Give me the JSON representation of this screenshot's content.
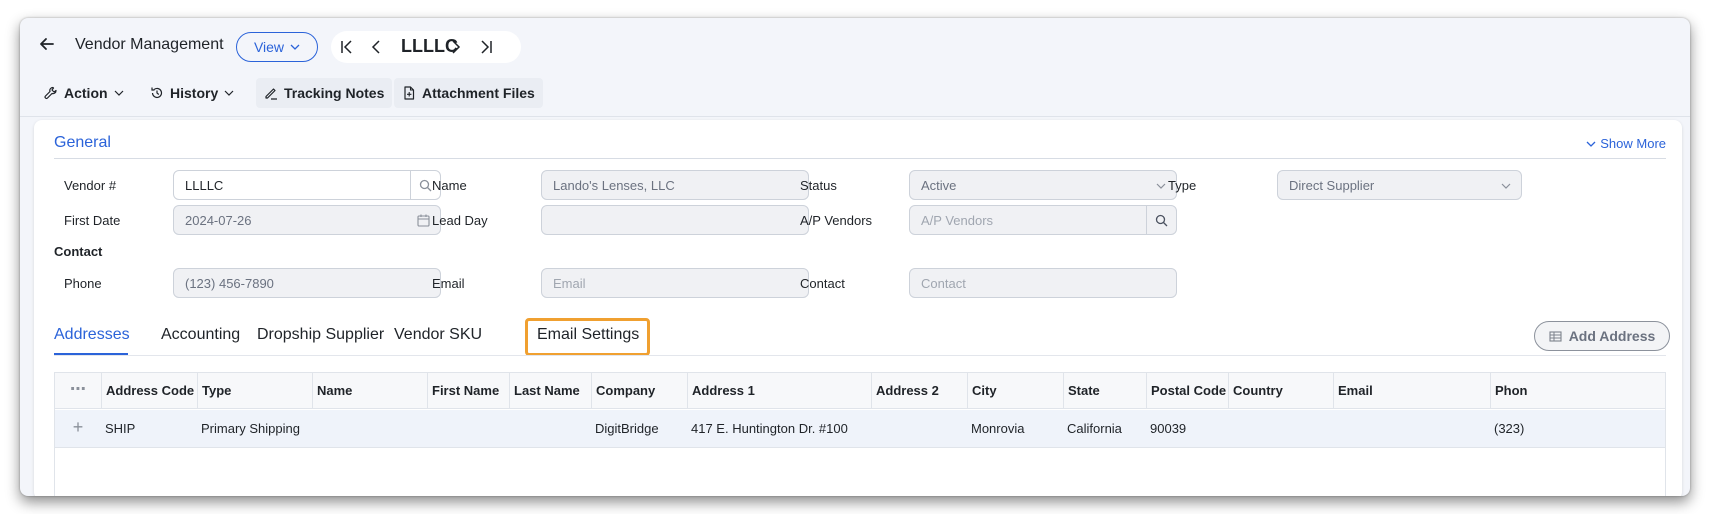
{
  "header": {
    "title": "Vendor Management",
    "view_label": "View",
    "record_id": "LLLLC"
  },
  "toolbar": {
    "action_label": "Action",
    "history_label": "History",
    "tracking_notes_label": "Tracking Notes",
    "attachment_files_label": "Attachment Files"
  },
  "general": {
    "section_title": "General",
    "show_more_label": "Show More",
    "fields": {
      "vendor_no": {
        "label": "Vendor #",
        "value": "LLLLC"
      },
      "name": {
        "label": "Name",
        "value": "Lando's Lenses, LLC"
      },
      "status": {
        "label": "Status",
        "value": "Active"
      },
      "type": {
        "label": "Type",
        "value": "Direct Supplier"
      },
      "first_date": {
        "label": "First Date",
        "value": "2024-07-26"
      },
      "lead_day": {
        "label": "Lead Day",
        "value": ""
      },
      "ap_vendors": {
        "label": "A/P Vendors",
        "placeholder": "A/P Vendors"
      }
    },
    "contact_heading": "Contact",
    "contact": {
      "phone": {
        "label": "Phone",
        "value": "(123) 456-7890"
      },
      "email": {
        "label": "Email",
        "placeholder": "Email"
      },
      "contact": {
        "label": "Contact",
        "placeholder": "Contact"
      }
    }
  },
  "tabs": {
    "items": [
      "Addresses",
      "Accounting",
      "Dropship Supplier",
      "Vendor SKU",
      "Email Settings"
    ],
    "active": "Addresses",
    "focused": "Email Settings",
    "add_address_label": "Add Address"
  },
  "table": {
    "columns": [
      "Address Code",
      "Type",
      "Name",
      "First Name",
      "Last Name",
      "Company",
      "Address 1",
      "Address 2",
      "City",
      "State",
      "Postal Code",
      "Country",
      "Email",
      "Phon"
    ],
    "rows": [
      {
        "expand": "+",
        "address_code": "SHIP",
        "type": "Primary Shipping",
        "name": "",
        "first_name": "",
        "last_name": "",
        "company": "DigitBridge",
        "address1": "417 E. Huntington Dr. #100",
        "address2": "",
        "city": "Monrovia",
        "state": "California",
        "postal_code": "90039",
        "country": "",
        "email": "",
        "phone": "(323)"
      }
    ]
  },
  "icons": {
    "back": "arrow-left-icon",
    "view_chevron": "chevron-down-icon",
    "first": "first-record-icon",
    "prev": "chevron-left-icon",
    "next": "chevron-right-icon",
    "last": "last-record-icon",
    "action": "wrench-icon",
    "history": "history-icon",
    "tracking": "pen-icon",
    "attachment": "file-icon",
    "search": "search-icon",
    "calendar": "calendar-icon",
    "dropdown": "chevron-down-icon",
    "add_address": "table-icon",
    "column_menu": "ellipsis-icon"
  },
  "colors": {
    "accent": "#2b63d9",
    "focus_ring": "#f0a030",
    "window_bg": "#f3f5fa",
    "row_highlight": "#eff3fa"
  }
}
